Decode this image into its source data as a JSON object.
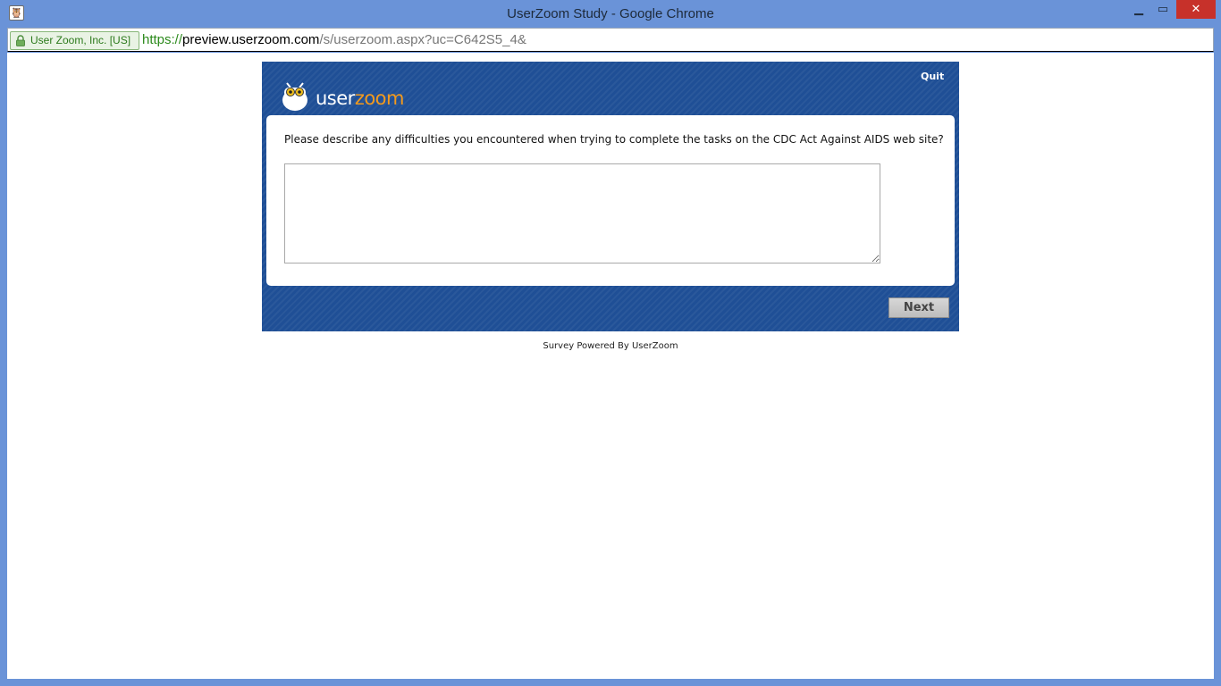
{
  "window": {
    "title": "UserZoom Study - Google Chrome",
    "minimize": "▁",
    "maximize": "▭",
    "close": "✕"
  },
  "addressbar": {
    "ev_badge": "User Zoom, Inc. [US]",
    "url_scheme": "https://",
    "url_host": "preview.userzoom.com",
    "url_path": "/s/userzoom.aspx?uc=C642S5_4&"
  },
  "survey": {
    "logo_part1": "user",
    "logo_part2": "zoom",
    "quit_label": "Quit",
    "question": "Please describe any difficulties you encountered when trying to complete the tasks on the CDC Act Against AIDS web site?",
    "answer_value": "",
    "next_label": "Next"
  },
  "footer": {
    "text": "Survey Powered By UserZoom"
  },
  "colors": {
    "survey_bg": "#1f4f96",
    "logo_accent": "#f39a1d",
    "close_button": "#c7312a"
  }
}
